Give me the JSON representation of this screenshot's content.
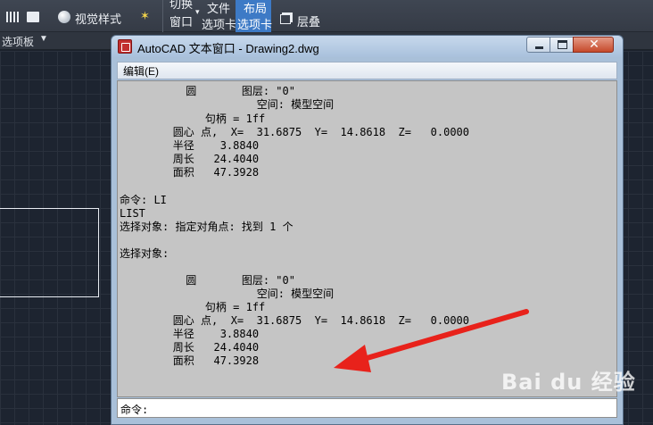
{
  "ribbon": {
    "item1": "视觉样式",
    "item2": "切换",
    "item3": "窗口",
    "item4": "文件",
    "item5": "选项卡",
    "item6": "布局",
    "item7": "选项卡",
    "item8": "层叠"
  },
  "panelbar": {
    "label": "选项板"
  },
  "window": {
    "title": "AutoCAD 文本窗口 - Drawing2.dwg",
    "menu": "编辑(E)",
    "lines": [
      "          圆       图层: \"0\"",
      "                     空间: 模型空间",
      "             句柄 = 1ff",
      "        圆心 点,  X=  31.6875  Y=  14.8618  Z=   0.0000",
      "        半径    3.8840",
      "        周长   24.4040",
      "        面积   47.3928",
      "",
      "",
      "命令: LI",
      "LIST",
      "选择对象: 指定对角点: 找到 1 个",
      "",
      "选择对象:",
      "",
      "          圆       图层: \"0\"",
      "                     空间: 模型空间",
      "             句柄 = 1ff",
      "        圆心 点,  X=  31.6875  Y=  14.8618  Z=   0.0000",
      "        半径    3.8840",
      "        周长   24.4040",
      "        面积   47.3928"
    ],
    "command_prompt": "命令:",
    "command_value": ""
  },
  "colors": {
    "arrow": "#e8221b",
    "window_frame": "#a9c0d9",
    "text_area": "#c5c5c5"
  },
  "watermark": {
    "text": "Bai du 经验",
    "url": "jingyan.baidu.com"
  }
}
